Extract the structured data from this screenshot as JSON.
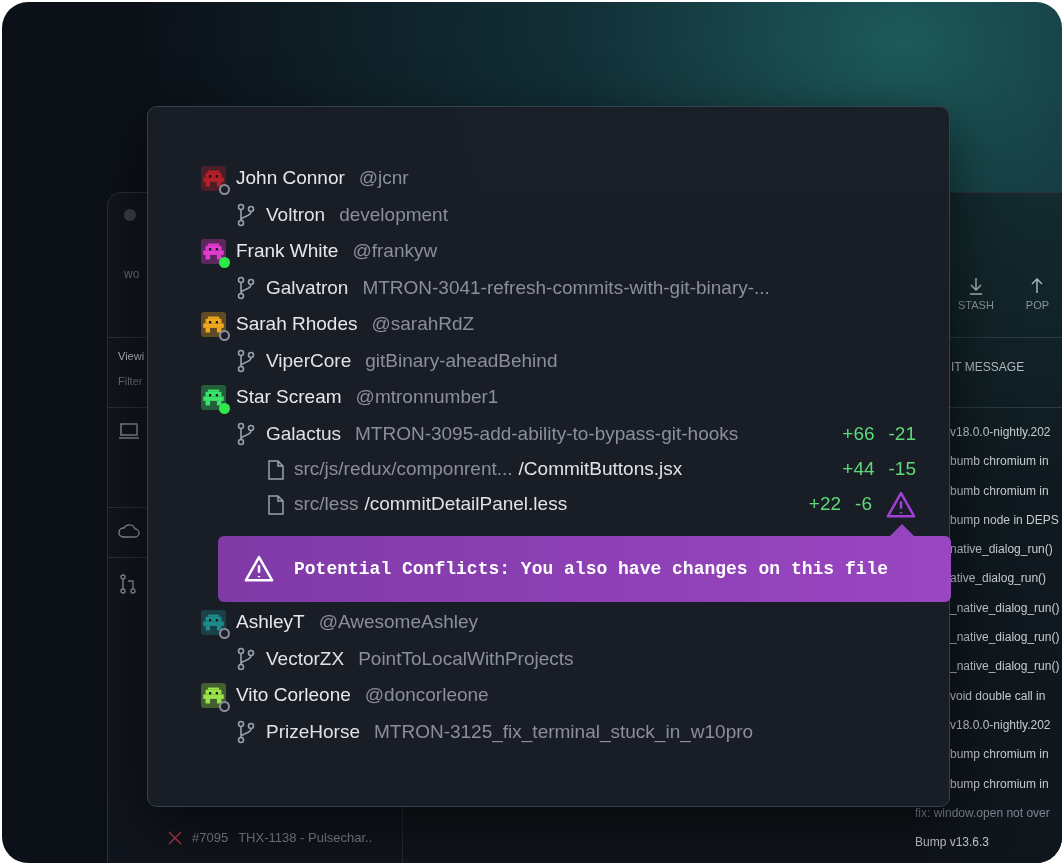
{
  "background_window": {
    "sidebar": {
      "header_text": "wo",
      "labels": [
        "Viewi",
        "Filter"
      ],
      "builds": [
        {
          "passed": false,
          "number": "#7095",
          "title": "THX-1138 - Pulsechar.."
        }
      ]
    },
    "toolbar": [
      {
        "kind": "stash",
        "label": "STASH"
      },
      {
        "kind": "pop",
        "label": "POP"
      }
    ],
    "commit_column": {
      "header": "IT MESSAGE",
      "messages": [
        "v18.0.0-nightly.202",
        "bumb chromium in",
        "bumb chromium in",
        "bump node in DEPS",
        "native_dialog_run()",
        "ative_dialog_run()",
        "_native_dialog_run()",
        "_native_dialog_run()",
        "_native_dialog_run()",
        "void double call in",
        "v18.0.0-nightly.202",
        "bump chromium in",
        "bump chromium in"
      ]
    },
    "footer_messages": [
      "fix: window.open not over",
      "Bump v13.6.3"
    ]
  },
  "panel": {
    "users": [
      {
        "name": "John Connor",
        "handle": "@jcnr",
        "online": false,
        "color": "#b3202a",
        "branches": [
          {
            "repo": "Voltron",
            "branch": "development"
          }
        ]
      },
      {
        "name": "Frank White",
        "handle": "@frankyw",
        "online": true,
        "color": "#e03ccf",
        "branches": [
          {
            "repo": "Galvatron",
            "branch": "MTRON-3041-refresh-commits-with-git-binary-..."
          }
        ]
      },
      {
        "name": "Sarah Rhodes",
        "handle": "@sarahRdZ",
        "online": false,
        "color": "#f0a820",
        "branches": [
          {
            "repo": "ViperCore",
            "branch": "gitBinary-aheadBehind"
          }
        ]
      },
      {
        "name": "Star Scream",
        "handle": "@mtronnumber1",
        "online": true,
        "color": "#3be36a",
        "branches": [
          {
            "repo": "Galactus",
            "branch": "MTRON-3095-add-ability-to-bypass-git-hooks",
            "added": "+66",
            "removed": "-21",
            "files": [
              {
                "dir": "src/js/redux/componrent...",
                "file": "/CommitButtons.jsx",
                "added": "+44",
                "removed": "-15",
                "conflict": false
              },
              {
                "dir": "src/less",
                "file": "/commitDetailPanel.less",
                "added": "+22",
                "removed": "-6",
                "conflict": true
              }
            ]
          }
        ]
      },
      {
        "name": "AshleyT",
        "handle": "@AwesomeAshley",
        "online": false,
        "color": "#1f8a8a",
        "branches": [
          {
            "repo": "VectorZX",
            "branch": "PointToLocalWithProjects"
          }
        ]
      },
      {
        "name": "Vito Corleone",
        "handle": "@doncorleone",
        "online": false,
        "color": "#9be34a",
        "branches": [
          {
            "repo": "PrizeHorse",
            "branch": "MTRON-3125_fix_terminal_stuck_in_w10pro"
          }
        ]
      }
    ]
  },
  "tooltip": {
    "text": "Potential Conflicts: You also have changes on this file"
  }
}
